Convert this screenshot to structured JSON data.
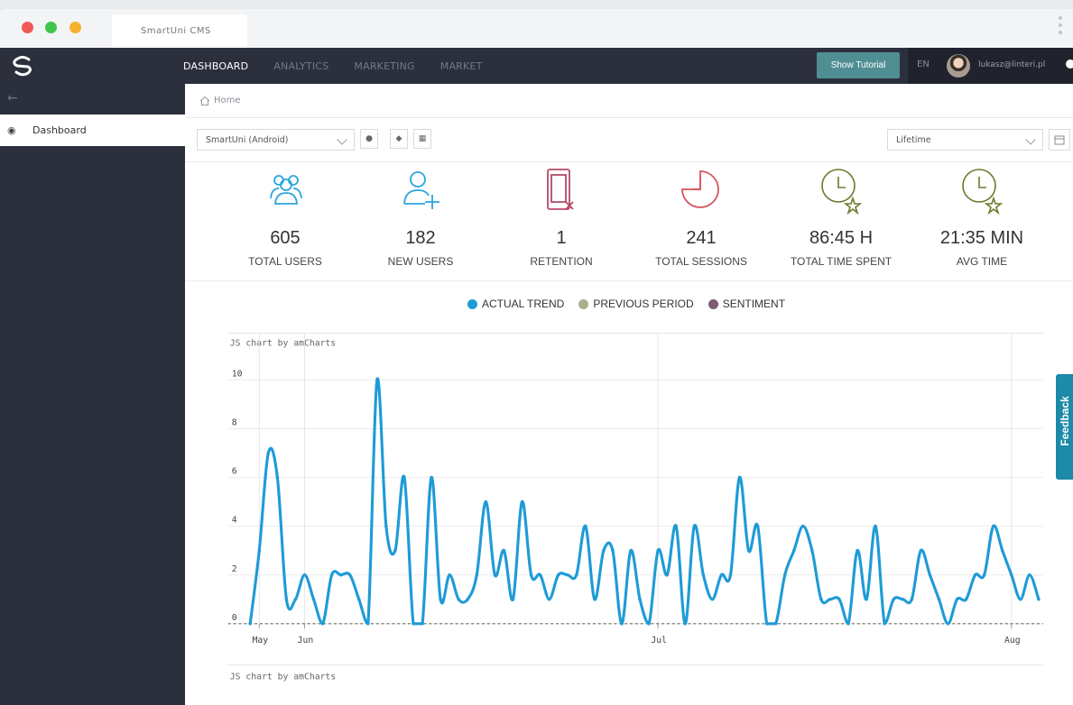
{
  "browser": {
    "tab_title": "SmartUni CMS"
  },
  "topbar": {
    "nav": [
      {
        "label": "DASHBOARD",
        "active": true
      },
      {
        "label": "ANALYTICS",
        "active": false
      },
      {
        "label": "MARKETING",
        "active": false
      },
      {
        "label": "MARKET",
        "active": false
      }
    ],
    "tutorial_label": "Show Tutorial",
    "language": "EN",
    "user_email": "lukasz@linteri.pl"
  },
  "sidebar": {
    "items": [
      {
        "label": "Dashboard",
        "icon": "dashboard-icon"
      }
    ]
  },
  "breadcrumb": {
    "home": "Home"
  },
  "filters": {
    "app_select": "SmartUni (Android)",
    "platforms": [
      "apple-icon",
      "android-icon",
      "windows-icon"
    ],
    "period_select": "Lifetime"
  },
  "stats": [
    {
      "value": "605",
      "label": "TOTAL USERS",
      "icon": "users-group-icon",
      "color": "#2aa6dd"
    },
    {
      "value": "182",
      "label": "NEW USERS",
      "icon": "add-user-icon",
      "color": "#2aa6dd"
    },
    {
      "value": "1",
      "label": "RETENTION",
      "icon": "phone-remove-icon",
      "color": "#b54a67"
    },
    {
      "value": "241",
      "label": "TOTAL SESSIONS",
      "icon": "session-clock-icon",
      "color": "#d6545e"
    },
    {
      "value": "86:45 H",
      "label": "TOTAL TIME SPENT",
      "icon": "clock-star-icon",
      "color": "#6a7b2c"
    },
    {
      "value": "21:35 MIN",
      "label": "AVG TIME",
      "icon": "clock-star-icon",
      "color": "#6a7b2c"
    }
  ],
  "legend": [
    {
      "label": "ACTUAL TREND",
      "color": "#1e9bd7"
    },
    {
      "label": "PREVIOUS PERIOD",
      "color": "#a8b08c"
    },
    {
      "label": "SENTIMENT",
      "color": "#7c5b73"
    }
  ],
  "chart_data": {
    "type": "line",
    "credit": "JS chart by amCharts",
    "credit_second": "JS chart by amCharts",
    "ylim": [
      0,
      10
    ],
    "yticks": [
      "0",
      "2",
      "4",
      "6",
      "8",
      "10"
    ],
    "x_ticks": [
      {
        "label": "May",
        "index": 1
      },
      {
        "label": "Jun",
        "index": 6
      },
      {
        "label": "Jul",
        "index": 45
      },
      {
        "label": "Aug",
        "index": 84
      }
    ],
    "series": [
      {
        "name": "ACTUAL TREND",
        "color": "#1e9bd7",
        "values": [
          0,
          3,
          7,
          6,
          1,
          1,
          2,
          1,
          0,
          2,
          2,
          2,
          1,
          0,
          10,
          4,
          3,
          6,
          0,
          0,
          6,
          1,
          2,
          1,
          1,
          2,
          5,
          2,
          3,
          1,
          5,
          2,
          2,
          1,
          2,
          2,
          2,
          4,
          1,
          3,
          3,
          0,
          3,
          1,
          0,
          3,
          2,
          4,
          0,
          4,
          2,
          1,
          2,
          2,
          6,
          3,
          4,
          0,
          0,
          2,
          3,
          4,
          3,
          1,
          1,
          1,
          0,
          3,
          1,
          4,
          0,
          1,
          1,
          1,
          3,
          2,
          1,
          0,
          1,
          1,
          2,
          2,
          4,
          3,
          2,
          1,
          2,
          1
        ],
        "note_values": "daily values May–Aug"
      },
      {
        "name": "PREVIOUS PERIOD",
        "color": "#a8b08c",
        "values_constant": 0
      },
      {
        "name": "SENTIMENT",
        "color": "#7c5b73",
        "values_constant": 0
      }
    ]
  },
  "feedback_tab": "Feedback"
}
